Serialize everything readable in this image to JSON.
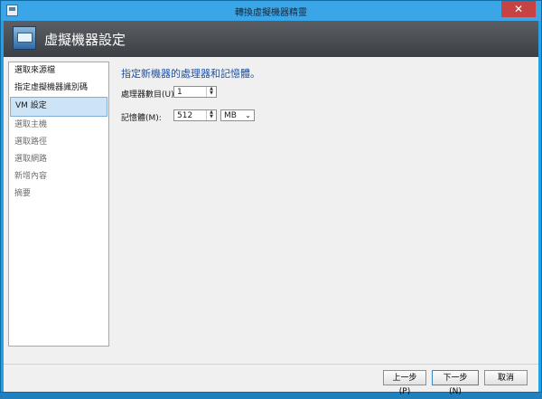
{
  "window": {
    "title": "轉換虛擬機器精靈",
    "close_glyph": "✕"
  },
  "header": {
    "title": "虛擬機器設定",
    "icon": "computer-icon"
  },
  "sidebar": {
    "items": [
      {
        "label": "選取來源檔",
        "state": "normal"
      },
      {
        "label": "指定虛擬機器識別碼",
        "state": "normal"
      },
      {
        "label": "VM 設定",
        "state": "selected"
      },
      {
        "label": "選取主機",
        "state": "disabled"
      },
      {
        "label": "選取路徑",
        "state": "disabled"
      },
      {
        "label": "選取網路",
        "state": "disabled"
      },
      {
        "label": "新增內容",
        "state": "disabled"
      },
      {
        "label": "摘要",
        "state": "disabled"
      }
    ]
  },
  "main": {
    "instruction": "指定新機器的處理器和記憶體。",
    "processors": {
      "label": "處理器數目(U):",
      "value": "1"
    },
    "memory": {
      "label": "記憶體(M):",
      "value": "512",
      "unit": "MB"
    }
  },
  "footer": {
    "back_label": "上一步(P)",
    "next_label": "下一步(N)",
    "cancel_label": "取消"
  },
  "colors": {
    "accent": "#1f4f9e",
    "titlebar": "#3aa6e8",
    "header": "#4a4d52"
  }
}
